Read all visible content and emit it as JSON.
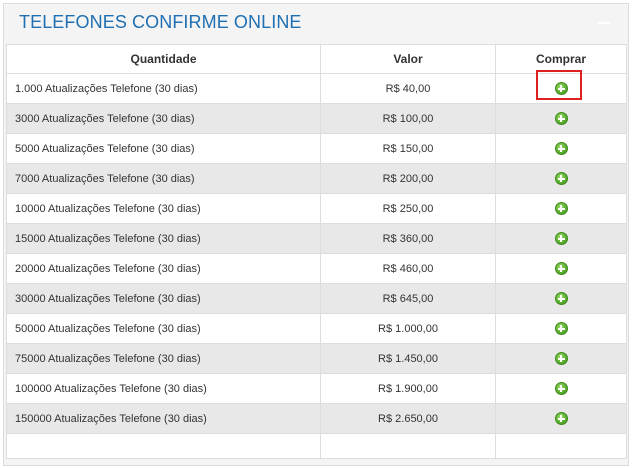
{
  "panel": {
    "title": "TELEFONES CONFIRME ONLINE"
  },
  "table": {
    "headers": {
      "quantity": "Quantidade",
      "value": "Valor",
      "buy": "Comprar"
    },
    "rows": [
      {
        "quantity": "1.000 Atualizações Telefone (30 dias)",
        "value": "R$ 40,00"
      },
      {
        "quantity": "3000 Atualizações Telefone (30 dias)",
        "value": "R$ 100,00"
      },
      {
        "quantity": "5000 Atualizações Telefone (30 dias)",
        "value": "R$ 150,00"
      },
      {
        "quantity": "7000 Atualizações Telefone (30 dias)",
        "value": "R$ 200,00"
      },
      {
        "quantity": "10000 Atualizações Telefone (30 dias)",
        "value": "R$ 250,00"
      },
      {
        "quantity": "15000 Atualizações Telefone (30 dias)",
        "value": "R$ 360,00"
      },
      {
        "quantity": "20000 Atualizações Telefone (30 dias)",
        "value": "R$ 460,00"
      },
      {
        "quantity": "30000 Atualizações Telefone (30 dias)",
        "value": "R$ 645,00"
      },
      {
        "quantity": "50000 Atualizações Telefone (30 dias)",
        "value": "R$ 1.000,00"
      },
      {
        "quantity": "75000 Atualizações Telefone (30 dias)",
        "value": "R$ 1.450,00"
      },
      {
        "quantity": "100000 Atualizações Telefone (30 dias)",
        "value": "R$ 1.900,00"
      },
      {
        "quantity": "150000 Atualizações Telefone (30 dias)",
        "value": "R$ 2.650,00"
      }
    ]
  },
  "icons": {
    "buy": "plus-circle-icon",
    "collapse": "minus-icon"
  },
  "colors": {
    "title": "#1f6fb2",
    "buy_button": "#5cb030",
    "highlight": "#e02020",
    "row_alt": "#e8e8e8"
  }
}
